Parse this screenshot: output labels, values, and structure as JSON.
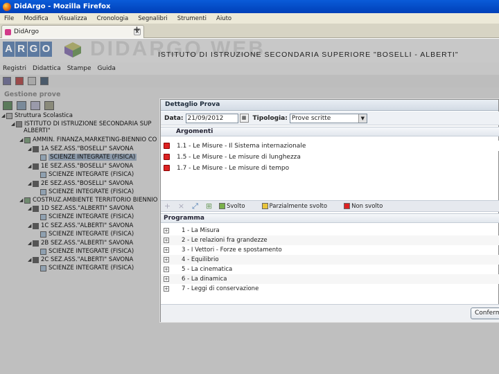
{
  "window": {
    "title": "DidArgo - Mozilla Firefox"
  },
  "firefox_menu": [
    "File",
    "Modifica",
    "Visualizza",
    "Cronologia",
    "Segnalibri",
    "Strumenti",
    "Aiuto"
  ],
  "tab": {
    "label": "DidArgo"
  },
  "header": {
    "logo_letters": [
      "A",
      "R",
      "G",
      "O"
    ],
    "brand": "DIDARGO WEB",
    "institute": "ISTITUTO DI ISTRUZIONE SECONDARIA SUPERIORE \"BOSELLI - ALBERTI\""
  },
  "app_menu": [
    "Registri",
    "Didattica",
    "Stampe",
    "Guida"
  ],
  "section": {
    "title": "Gestione prove"
  },
  "tree": {
    "root": "Struttura Scolastica",
    "school": "ISTITUTO DI ISTRUZIONE SECONDARIA SUPERIORE \"BOSELLI - ALBERTI\"",
    "school_line1": "ISTITUTO DI ISTRUZIONE SECONDARIA SUP",
    "school_line2": "ALBERTI\"",
    "items": [
      {
        "label": "AMMIN. FINANZA,MARKETING-BIENNIO CO",
        "kind": "course"
      },
      {
        "label": "1A SEZ.ASS.\"BOSELLI\" SAVONA",
        "kind": "cls"
      },
      {
        "label": "SCIENZE INTEGRATE (FISICA)",
        "kind": "subj"
      },
      {
        "label": "1E SEZ.ASS.\"BOSELLI\" SAVONA",
        "kind": "cls"
      },
      {
        "label": "SCIENZE INTEGRATE (FISICA)",
        "kind": "subj"
      },
      {
        "label": "2E SEZ.ASS.\"BOSELLI\" SAVONA",
        "kind": "cls"
      },
      {
        "label": "SCIENZE INTEGRATE (FISICA)",
        "kind": "subj"
      },
      {
        "label": "COSTRUZ.AMBIENTE TERRITORIO BIENNIO",
        "kind": "course"
      },
      {
        "label": "1D SEZ.ASS.\"ALBERTI\" SAVONA",
        "kind": "cls"
      },
      {
        "label": "SCIENZE INTEGRATE (FISICA)",
        "kind": "subj"
      },
      {
        "label": "1C SEZ.ASS.\"ALBERTI\" SAVONA",
        "kind": "cls"
      },
      {
        "label": "SCIENZE INTEGRATE (FISICA)",
        "kind": "subj"
      },
      {
        "label": "2B SEZ.ASS.\"ALBERTI\" SAVONA",
        "kind": "cls"
      },
      {
        "label": "SCIENZE INTEGRATE (FISICA)",
        "kind": "subj"
      },
      {
        "label": "2C SEZ.ASS.\"ALBERTI\" SAVONA",
        "kind": "cls"
      },
      {
        "label": "SCIENZE INTEGRATE (FISICA)",
        "kind": "subj"
      }
    ]
  },
  "dialog": {
    "title": "Dettaglio Prova",
    "date_label": "Data:",
    "date_value": "21/09/2012",
    "type_label": "Tipologia:",
    "type_value": "Prove scritte",
    "arguments_header": "Argomenti",
    "arguments": [
      "1.1 - Le Misure - Il Sistema internazionale",
      "1.5 - Le Misure - Le misure di lunghezza",
      "1.7 - Le Misure - Le misure di tempo"
    ],
    "actions": {
      "done": "Svolto",
      "partial": "Parzialmente svolto",
      "not_done": "Non svolto"
    },
    "program_header": "Programma",
    "program": [
      "1 - La Misura",
      "2 - Le relazioni fra grandezze",
      "3 - I Vettori - Forze e spostamento",
      "4 - Equilibrio",
      "5 - La cinematica",
      "6 - La dinamica",
      "7 - Leggi di conservazione"
    ],
    "confirm_label": "Conferma"
  },
  "colors": {
    "titlebar": "#0a5bd8",
    "disabled_bg": "#bfbfbf",
    "red_cube": "#dd2222"
  }
}
